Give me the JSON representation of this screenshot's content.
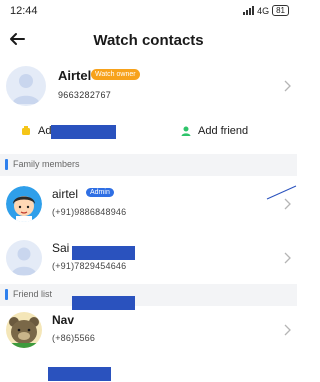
{
  "status_bar": {
    "time": "12:44",
    "network": "4G",
    "battery": "81"
  },
  "header": {
    "title": "Watch contacts"
  },
  "owner": {
    "name": "Airtel",
    "badge": "Watch owner",
    "phone": "9663282767"
  },
  "actions": {
    "left_label": "Ad",
    "right_label": "Add friend"
  },
  "family_section": {
    "label": "Family members"
  },
  "family_members": [
    {
      "name": "airtel",
      "badge": "Admin",
      "phone": "(+91)9886848946"
    },
    {
      "name": "Sai",
      "phone": "(+91)7829454646"
    }
  ],
  "friend_section": {
    "label": "Friend list"
  },
  "friends": [
    {
      "name": "Nav",
      "phone": "(+86)5566"
    }
  ],
  "colors": {
    "accent": "#2f80ed",
    "owner_badge": "#f7a21b",
    "admin_badge": "#2f6fe4",
    "redaction": "#2a52be"
  },
  "icons": [
    "back-arrow-icon",
    "chevron-right-icon",
    "watch-icon",
    "person-add-icon"
  ]
}
